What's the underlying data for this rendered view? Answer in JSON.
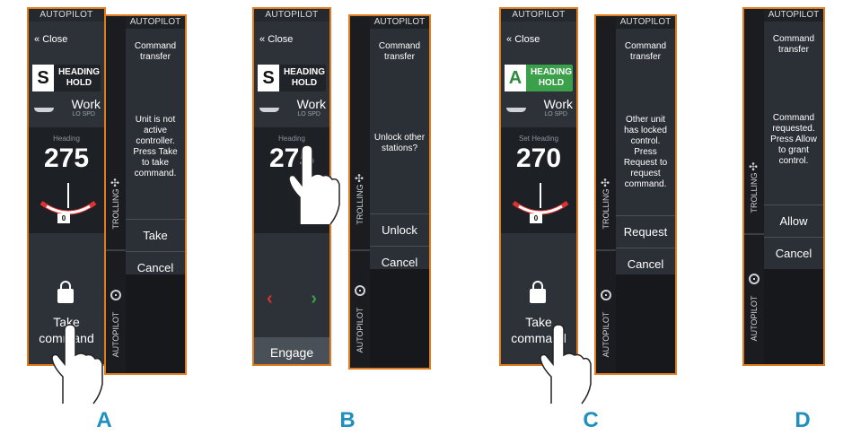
{
  "panels": [
    {
      "letter": "A",
      "controller": {
        "title": "AUTOPILOT",
        "close": "Close",
        "mode_letter": "S",
        "mode_text": "HEADING HOLD",
        "work_label": "Work",
        "lospd": "LO SPD",
        "heading_label": "Heading",
        "heading_value": "275",
        "rudder_value": "0",
        "action_label": "Take command"
      },
      "dialog": {
        "side_top": "TROLLING",
        "side_bottom": "AUTOPILOT",
        "title": "AUTOPILOT",
        "heading": "Command transfer",
        "message": "Unit is not active controller. Press Take to take command.",
        "buttons": [
          "Take",
          "Cancel"
        ]
      }
    },
    {
      "letter": "B",
      "controller": {
        "title": "AUTOPILOT",
        "close": "Close",
        "mode_letter": "S",
        "mode_text": "HEADING HOLD",
        "work_label": "Work",
        "lospd": "LO SPD",
        "heading_label": "Heading",
        "heading_value": "275",
        "engage_label": "Engage"
      },
      "dialog": {
        "side_top": "TROLLING",
        "side_bottom": "AUTOPILOT",
        "title": "AUTOPILOT",
        "heading": "Command transfer",
        "message": "Unlock other stations?",
        "buttons": [
          "Unlock",
          "Cancel"
        ]
      }
    },
    {
      "letter": "C",
      "controller": {
        "title": "AUTOPILOT",
        "close": "Close",
        "mode_letter": "A",
        "mode_text": "HEADING HOLD",
        "work_label": "Work",
        "lospd": "LO SPD",
        "heading_label": "Set Heading",
        "heading_value": "270",
        "rudder_value": "0",
        "action_label": "Take command"
      },
      "dialog": {
        "side_top": "TROLLING",
        "side_bottom": "AUTOPILOT",
        "title": "AUTOPILOT",
        "heading": "Command transfer",
        "message": "Other unit has locked control. Press Request to request command.",
        "buttons": [
          "Request",
          "Cancel"
        ]
      }
    },
    {
      "letter": "D",
      "dialog": {
        "side_top": "TROLLING",
        "side_bottom": "AUTOPILOT",
        "title": "AUTOPILOT",
        "heading": "Command transfer",
        "message": "Command requested. Press Allow to grant control.",
        "buttons": [
          "Allow",
          "Cancel"
        ]
      }
    }
  ],
  "colors": {
    "accent": "#e07b1f",
    "green": "#3aa14a",
    "letter": "#1f8fbf"
  }
}
